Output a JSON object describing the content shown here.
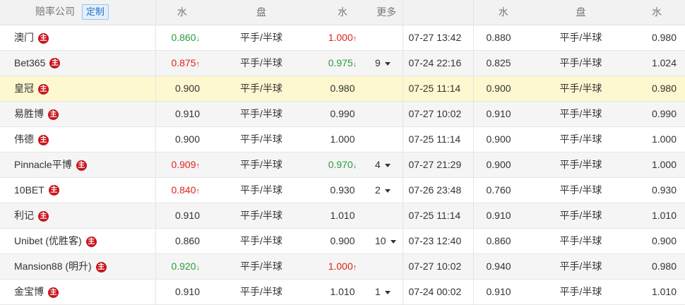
{
  "header": {
    "company": "赔率公司",
    "custom_button": "定制",
    "col_water1": "水",
    "col_pan1": "盘",
    "col_water2": "水",
    "col_more": "更多",
    "col_water3": "水",
    "col_pan2": "盘",
    "col_water4": "水"
  },
  "badge_char": "主",
  "colors": {
    "up": "#e2231a",
    "down": "#2a9a3a",
    "highlight_row": "#fdf8cf",
    "badge": "#c8141b"
  },
  "rows": [
    {
      "company": "澳门",
      "w1": "0.860",
      "w1_trend": "down",
      "pan1": "平手/半球",
      "w2": "1.000",
      "w2_trend": "up",
      "more": "",
      "time": "07-27 13:42",
      "w3": "0.880",
      "pan2": "平手/半球",
      "w4": "0.980"
    },
    {
      "company": "Bet365",
      "w1": "0.875",
      "w1_trend": "up",
      "pan1": "平手/半球",
      "w2": "0.975",
      "w2_trend": "down",
      "more": "9",
      "time": "07-24 22:16",
      "w3": "0.825",
      "pan2": "平手/半球",
      "w4": "1.024"
    },
    {
      "company": "皇冠",
      "w1": "0.900",
      "w1_trend": "",
      "pan1": "平手/半球",
      "w2": "0.980",
      "w2_trend": "",
      "more": "",
      "time": "07-25 11:14",
      "w3": "0.900",
      "pan2": "平手/半球",
      "w4": "0.980",
      "highlight": true
    },
    {
      "company": "易胜博",
      "w1": "0.910",
      "w1_trend": "",
      "pan1": "平手/半球",
      "w2": "0.990",
      "w2_trend": "",
      "more": "",
      "time": "07-27 10:02",
      "w3": "0.910",
      "pan2": "平手/半球",
      "w4": "0.990"
    },
    {
      "company": "伟德",
      "w1": "0.900",
      "w1_trend": "",
      "pan1": "平手/半球",
      "w2": "1.000",
      "w2_trend": "",
      "more": "",
      "time": "07-25 11:14",
      "w3": "0.900",
      "pan2": "平手/半球",
      "w4": "1.000"
    },
    {
      "company": "Pinnacle平博",
      "w1": "0.909",
      "w1_trend": "up",
      "pan1": "平手/半球",
      "w2": "0.970",
      "w2_trend": "down",
      "more": "4",
      "time": "07-27 21:29",
      "w3": "0.900",
      "pan2": "平手/半球",
      "w4": "1.000"
    },
    {
      "company": "10BET",
      "w1": "0.840",
      "w1_trend": "up",
      "pan1": "平手/半球",
      "w2": "0.930",
      "w2_trend": "",
      "more": "2",
      "time": "07-26 23:48",
      "w3": "0.760",
      "pan2": "平手/半球",
      "w4": "0.930"
    },
    {
      "company": "利记",
      "w1": "0.910",
      "w1_trend": "",
      "pan1": "平手/半球",
      "w2": "1.010",
      "w2_trend": "",
      "more": "",
      "time": "07-25 11:14",
      "w3": "0.910",
      "pan2": "平手/半球",
      "w4": "1.010"
    },
    {
      "company": "Unibet (优胜客)",
      "w1": "0.860",
      "w1_trend": "",
      "pan1": "平手/半球",
      "w2": "0.900",
      "w2_trend": "",
      "more": "10",
      "time": "07-23 12:40",
      "w3": "0.860",
      "pan2": "平手/半球",
      "w4": "0.900"
    },
    {
      "company": "Mansion88 (明升)",
      "w1": "0.920",
      "w1_trend": "down",
      "pan1": "平手/半球",
      "w2": "1.000",
      "w2_trend": "up",
      "more": "",
      "time": "07-27 10:02",
      "w3": "0.940",
      "pan2": "平手/半球",
      "w4": "0.980"
    },
    {
      "company": "金宝博",
      "w1": "0.910",
      "w1_trend": "",
      "pan1": "平手/半球",
      "w2": "1.010",
      "w2_trend": "",
      "more": "1",
      "time": "07-24 00:02",
      "w3": "0.910",
      "pan2": "平手/半球",
      "w4": "1.010"
    }
  ]
}
